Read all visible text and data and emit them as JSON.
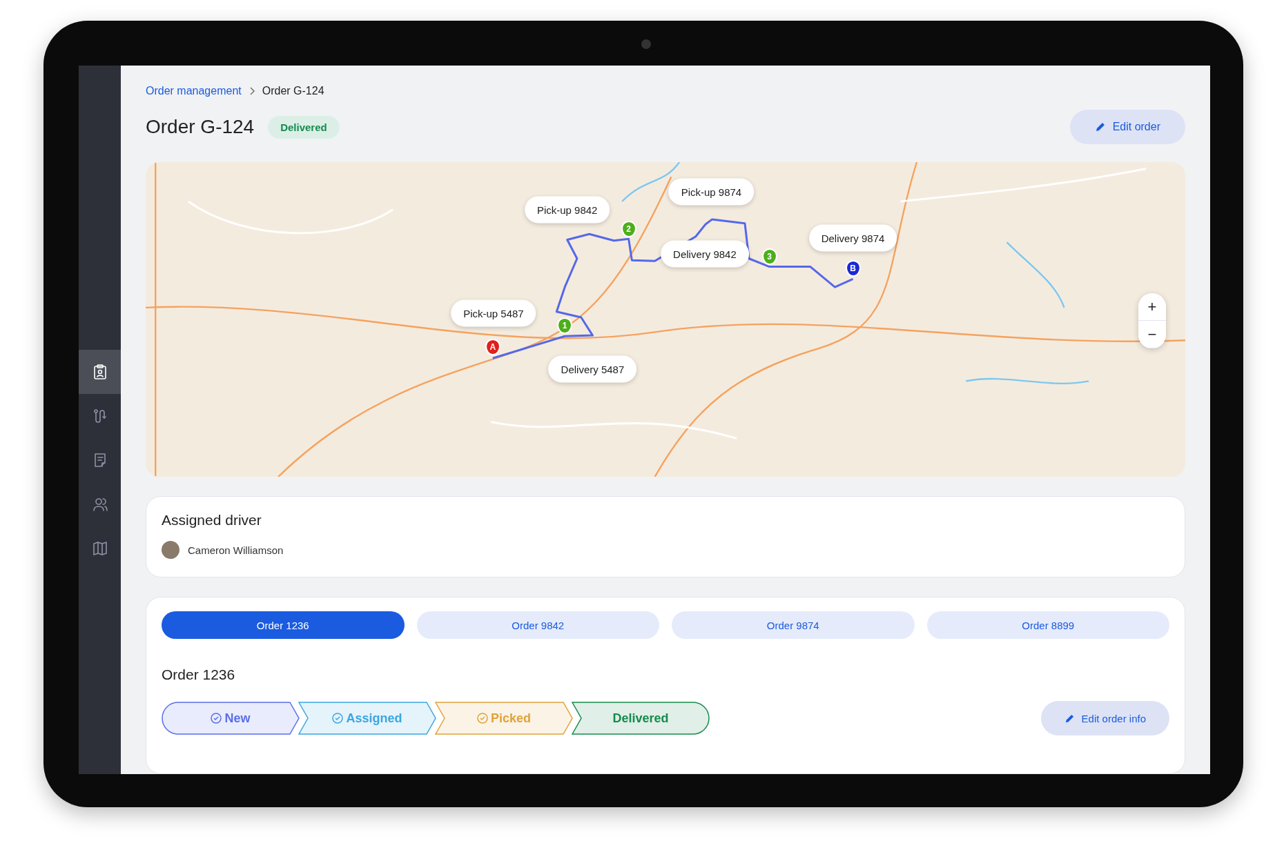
{
  "sidebar": {
    "items": [
      {
        "selected": true
      },
      {
        "selected": false
      },
      {
        "selected": false
      },
      {
        "selected": false
      },
      {
        "selected": false
      }
    ]
  },
  "breadcrumb": {
    "parent": "Order management",
    "current": "Order G-124"
  },
  "header": {
    "title": "Order G-124",
    "status": "Delivered",
    "edit_button": "Edit order"
  },
  "map": {
    "callouts": [
      {
        "text": "Pick-up 9842"
      },
      {
        "text": "Pick-up 9874"
      },
      {
        "text": "Delivery 9874"
      },
      {
        "text": "Delivery 9842"
      },
      {
        "text": "Pick-up 5487"
      },
      {
        "text": "Delivery 5487"
      }
    ],
    "markers": [
      {
        "label": "A",
        "color": "#e0201c"
      },
      {
        "label": "1",
        "color": "#4caf1a"
      },
      {
        "label": "2",
        "color": "#4caf1a"
      },
      {
        "label": "3",
        "color": "#4caf1a"
      },
      {
        "label": "B",
        "color": "#1a2ad6"
      }
    ],
    "zoom_in": "+",
    "zoom_out": "−"
  },
  "driver": {
    "heading": "Assigned driver",
    "name": "Cameron Williamson"
  },
  "orders": {
    "tabs": [
      {
        "label": "Order 1236",
        "selected": true
      },
      {
        "label": "Order 9842",
        "selected": false
      },
      {
        "label": "Order 9874",
        "selected": false
      },
      {
        "label": "Order 8899",
        "selected": false
      }
    ],
    "title": "Order 1236",
    "steps": [
      {
        "label": "New",
        "checked": true,
        "color": "#5b6ee8"
      },
      {
        "label": "Assigned",
        "checked": true,
        "color": "#3aa6e0"
      },
      {
        "label": "Picked",
        "checked": true,
        "color": "#e0a23a"
      },
      {
        "label": "Delivered",
        "checked": false,
        "color": "#168a4e"
      }
    ],
    "edit_button": "Edit order info"
  }
}
